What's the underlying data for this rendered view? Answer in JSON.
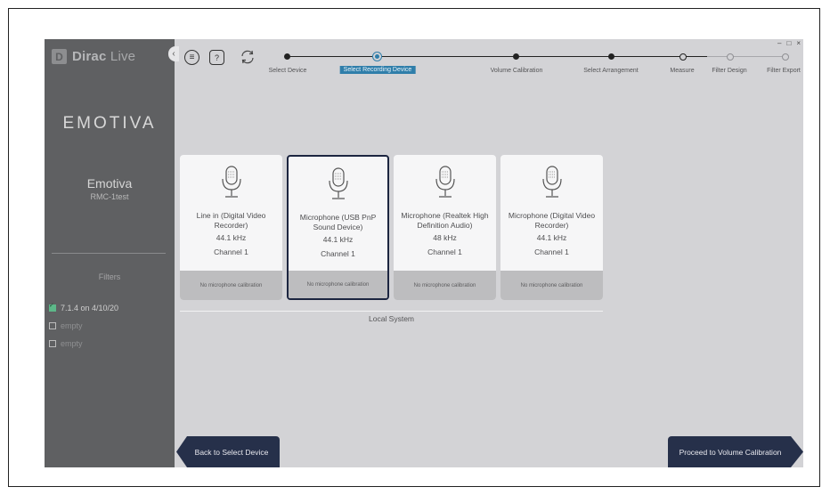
{
  "app": {
    "logo_mark": "D",
    "logo_name": "Dirac",
    "logo_suffix": "Live",
    "window_controls": {
      "minimize": "–",
      "maximize": "□",
      "close": "×"
    }
  },
  "sidebar": {
    "brand": "EMOTIVA",
    "device_name": "Emotiva",
    "device_model": "RMC-1test",
    "filters_title": "Filters",
    "filters": [
      {
        "label": "7.1.4 on 4/10/20",
        "checked": true
      },
      {
        "label": "empty",
        "checked": false
      },
      {
        "label": "empty",
        "checked": false
      }
    ],
    "collapse_glyph": "‹"
  },
  "toolbar": {
    "menu_glyph": "≡",
    "help_glyph": "?"
  },
  "steps": [
    {
      "label": "Select Device",
      "state": "done"
    },
    {
      "label": "Select Recording Device",
      "state": "current"
    },
    {
      "label": "Volume Calibration",
      "state": "done"
    },
    {
      "label": "Select Arrangement",
      "state": "done"
    },
    {
      "label": "Measure",
      "state": "open"
    },
    {
      "label": "Filter Design",
      "state": "future"
    },
    {
      "label": "Filter Export",
      "state": "future"
    }
  ],
  "devices": [
    {
      "name": "Line in (Digital Video Recorder)",
      "rate": "44.1 kHz",
      "channel": "Channel 1",
      "calibration": "No microphone calibration",
      "selected": false,
      "icon": "microphone-icon"
    },
    {
      "name": "Microphone (USB PnP Sound Device)",
      "rate": "44.1 kHz",
      "channel": "Channel 1",
      "calibration": "No microphone calibration",
      "selected": true,
      "icon": "microphone-icon"
    },
    {
      "name": "Microphone (Realtek High Definition Audio)",
      "rate": "48 kHz",
      "channel": "Channel 1",
      "calibration": "No microphone calibration",
      "selected": false,
      "icon": "microphone-icon"
    },
    {
      "name": "Microphone (Digital Video Recorder)",
      "rate": "44.1 kHz",
      "channel": "Channel 1",
      "calibration": "No microphone calibration",
      "selected": false,
      "icon": "microphone-icon"
    }
  ],
  "system_label": "Local System",
  "nav": {
    "back_label": "Back to Select Device",
    "next_label": "Proceed to Volume Calibration"
  },
  "colors": {
    "accent": "#2f7eaa",
    "nav_button": "#26304a",
    "sidebar": "#5f6062",
    "background": "#d3d3d6"
  }
}
